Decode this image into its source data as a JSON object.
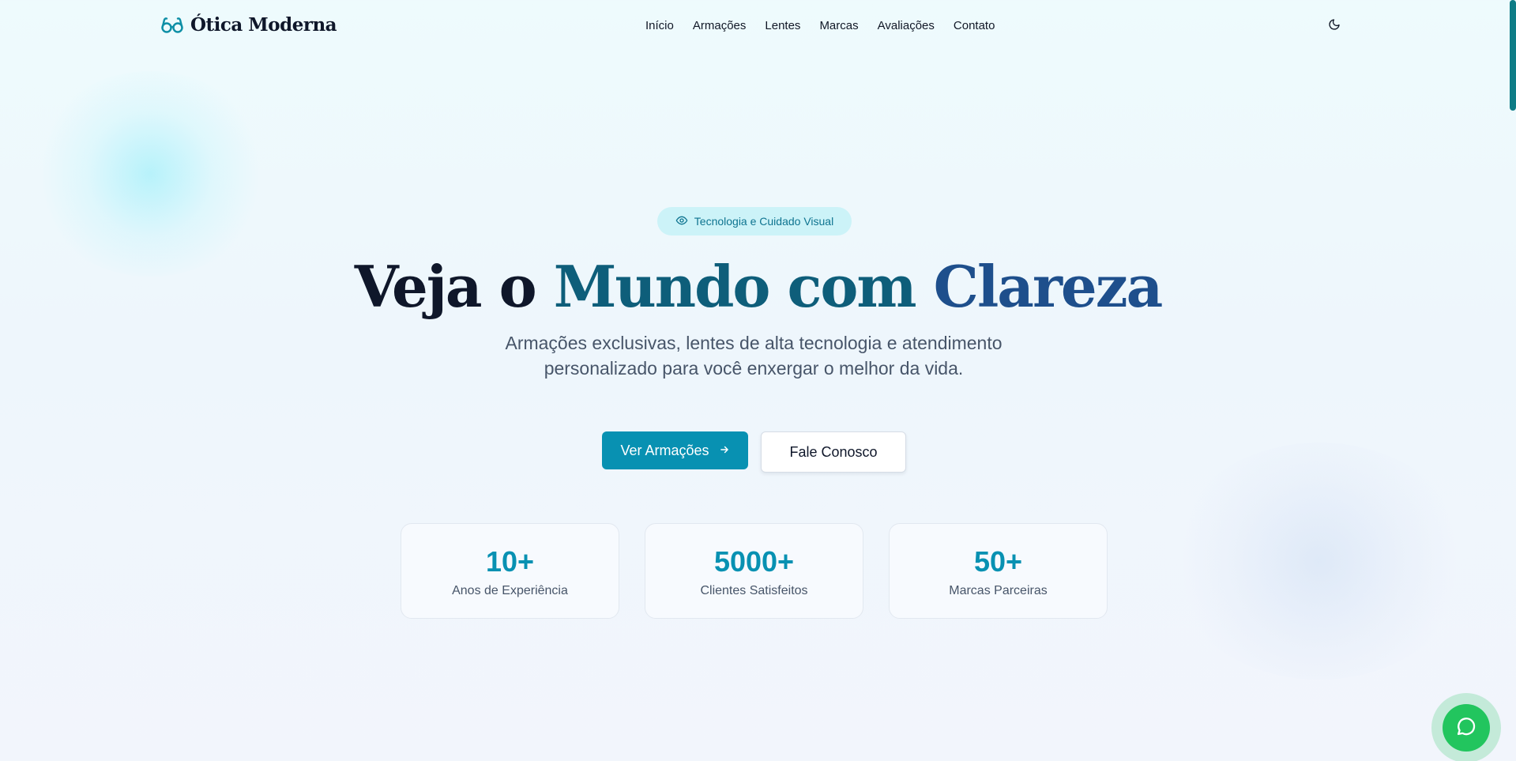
{
  "header": {
    "logo_text": "Ótica Moderna",
    "logo_icon": "glasses-icon",
    "nav": [
      {
        "label": "Início"
      },
      {
        "label": "Armações"
      },
      {
        "label": "Lentes"
      },
      {
        "label": "Marcas"
      },
      {
        "label": "Avaliações"
      },
      {
        "label": "Contato"
      }
    ],
    "theme_toggle_icon": "moon-icon"
  },
  "hero": {
    "badge_icon": "eye-icon",
    "badge_text": "Tecnologia e Cuidado Visual",
    "headline_part1": "Veja o ",
    "headline_part2": "Mundo com ",
    "headline_part3": "Clareza",
    "subtitle": "Armações exclusivas, lentes de alta tecnologia e atendimento personalizado para você enxergar o melhor da vida.",
    "primary_button": "Ver Armações",
    "primary_button_icon": "arrow-right-icon",
    "secondary_button": "Fale Conosco"
  },
  "stats": [
    {
      "value": "10+",
      "label": "Anos de Experiência"
    },
    {
      "value": "5000+",
      "label": "Clientes Satisfeitos"
    },
    {
      "value": "50+",
      "label": "Marcas Parceiras"
    }
  ],
  "floating": {
    "chat_icon": "whatsapp-icon"
  },
  "colors": {
    "accent": "#0891b2",
    "badge_bg": "#ccf3f8",
    "whatsapp": "#22c55e"
  }
}
